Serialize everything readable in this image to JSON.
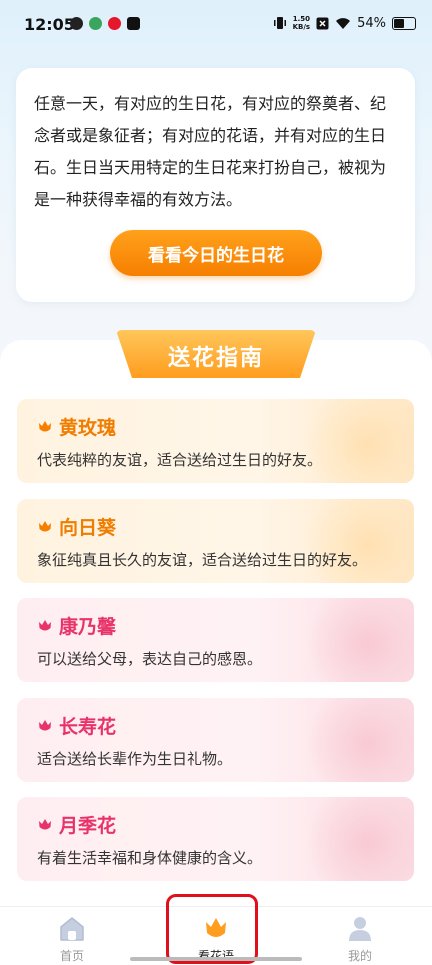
{
  "status_bar": {
    "time": "12:05",
    "net_speed_value": "1.50",
    "net_speed_unit": "KB/s",
    "battery": "54%",
    "battery_level": 0.54
  },
  "intro": {
    "text": "任意一天，有对应的生日花，有对应的祭奠者、纪念者或是象征者；有对应的花语，并有对应的生日石。生日当天用特定的生日花来打扮自己，被视为是一种获得幸福的有效方法。",
    "button_label": "看看今日的生日花"
  },
  "guide": {
    "title": "送花指南",
    "items": [
      {
        "name": "黄玫瑰",
        "desc": "代表纯粹的友谊，适合送给过生日的好友。",
        "theme": "orange"
      },
      {
        "name": "向日葵",
        "desc": "象征纯真且长久的友谊，适合送给过生日的好友。",
        "theme": "orange"
      },
      {
        "name": "康乃馨",
        "desc": "可以送给父母，表达自己的感恩。",
        "theme": "pink"
      },
      {
        "name": "长寿花",
        "desc": "适合送给长辈作为生日礼物。",
        "theme": "pink"
      },
      {
        "name": "月季花",
        "desc": "有着生活幸福和身体健康的含义。",
        "theme": "pink"
      }
    ]
  },
  "tabs": [
    {
      "label": "首页",
      "icon": "home-icon"
    },
    {
      "label": "看花语",
      "icon": "flower-icon"
    },
    {
      "label": "我的",
      "icon": "user-icon"
    }
  ],
  "colors": {
    "accent_orange": "#f77f00",
    "accent_pink": "#e8336a",
    "highlight_red": "#e0101a"
  }
}
